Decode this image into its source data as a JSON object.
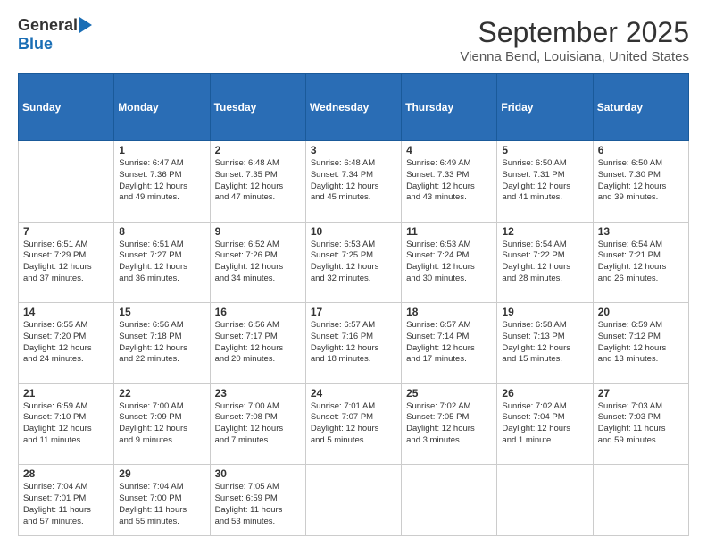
{
  "header": {
    "logo_general": "General",
    "logo_blue": "Blue",
    "month_title": "September 2025",
    "location": "Vienna Bend, Louisiana, United States"
  },
  "calendar": {
    "days_of_week": [
      "Sunday",
      "Monday",
      "Tuesday",
      "Wednesday",
      "Thursday",
      "Friday",
      "Saturday"
    ],
    "weeks": [
      [
        {
          "day": "",
          "info": ""
        },
        {
          "day": "1",
          "info": "Sunrise: 6:47 AM\nSunset: 7:36 PM\nDaylight: 12 hours\nand 49 minutes."
        },
        {
          "day": "2",
          "info": "Sunrise: 6:48 AM\nSunset: 7:35 PM\nDaylight: 12 hours\nand 47 minutes."
        },
        {
          "day": "3",
          "info": "Sunrise: 6:48 AM\nSunset: 7:34 PM\nDaylight: 12 hours\nand 45 minutes."
        },
        {
          "day": "4",
          "info": "Sunrise: 6:49 AM\nSunset: 7:33 PM\nDaylight: 12 hours\nand 43 minutes."
        },
        {
          "day": "5",
          "info": "Sunrise: 6:50 AM\nSunset: 7:31 PM\nDaylight: 12 hours\nand 41 minutes."
        },
        {
          "day": "6",
          "info": "Sunrise: 6:50 AM\nSunset: 7:30 PM\nDaylight: 12 hours\nand 39 minutes."
        }
      ],
      [
        {
          "day": "7",
          "info": "Sunrise: 6:51 AM\nSunset: 7:29 PM\nDaylight: 12 hours\nand 37 minutes."
        },
        {
          "day": "8",
          "info": "Sunrise: 6:51 AM\nSunset: 7:27 PM\nDaylight: 12 hours\nand 36 minutes."
        },
        {
          "day": "9",
          "info": "Sunrise: 6:52 AM\nSunset: 7:26 PM\nDaylight: 12 hours\nand 34 minutes."
        },
        {
          "day": "10",
          "info": "Sunrise: 6:53 AM\nSunset: 7:25 PM\nDaylight: 12 hours\nand 32 minutes."
        },
        {
          "day": "11",
          "info": "Sunrise: 6:53 AM\nSunset: 7:24 PM\nDaylight: 12 hours\nand 30 minutes."
        },
        {
          "day": "12",
          "info": "Sunrise: 6:54 AM\nSunset: 7:22 PM\nDaylight: 12 hours\nand 28 minutes."
        },
        {
          "day": "13",
          "info": "Sunrise: 6:54 AM\nSunset: 7:21 PM\nDaylight: 12 hours\nand 26 minutes."
        }
      ],
      [
        {
          "day": "14",
          "info": "Sunrise: 6:55 AM\nSunset: 7:20 PM\nDaylight: 12 hours\nand 24 minutes."
        },
        {
          "day": "15",
          "info": "Sunrise: 6:56 AM\nSunset: 7:18 PM\nDaylight: 12 hours\nand 22 minutes."
        },
        {
          "day": "16",
          "info": "Sunrise: 6:56 AM\nSunset: 7:17 PM\nDaylight: 12 hours\nand 20 minutes."
        },
        {
          "day": "17",
          "info": "Sunrise: 6:57 AM\nSunset: 7:16 PM\nDaylight: 12 hours\nand 18 minutes."
        },
        {
          "day": "18",
          "info": "Sunrise: 6:57 AM\nSunset: 7:14 PM\nDaylight: 12 hours\nand 17 minutes."
        },
        {
          "day": "19",
          "info": "Sunrise: 6:58 AM\nSunset: 7:13 PM\nDaylight: 12 hours\nand 15 minutes."
        },
        {
          "day": "20",
          "info": "Sunrise: 6:59 AM\nSunset: 7:12 PM\nDaylight: 12 hours\nand 13 minutes."
        }
      ],
      [
        {
          "day": "21",
          "info": "Sunrise: 6:59 AM\nSunset: 7:10 PM\nDaylight: 12 hours\nand 11 minutes."
        },
        {
          "day": "22",
          "info": "Sunrise: 7:00 AM\nSunset: 7:09 PM\nDaylight: 12 hours\nand 9 minutes."
        },
        {
          "day": "23",
          "info": "Sunrise: 7:00 AM\nSunset: 7:08 PM\nDaylight: 12 hours\nand 7 minutes."
        },
        {
          "day": "24",
          "info": "Sunrise: 7:01 AM\nSunset: 7:07 PM\nDaylight: 12 hours\nand 5 minutes."
        },
        {
          "day": "25",
          "info": "Sunrise: 7:02 AM\nSunset: 7:05 PM\nDaylight: 12 hours\nand 3 minutes."
        },
        {
          "day": "26",
          "info": "Sunrise: 7:02 AM\nSunset: 7:04 PM\nDaylight: 12 hours\nand 1 minute."
        },
        {
          "day": "27",
          "info": "Sunrise: 7:03 AM\nSunset: 7:03 PM\nDaylight: 11 hours\nand 59 minutes."
        }
      ],
      [
        {
          "day": "28",
          "info": "Sunrise: 7:04 AM\nSunset: 7:01 PM\nDaylight: 11 hours\nand 57 minutes."
        },
        {
          "day": "29",
          "info": "Sunrise: 7:04 AM\nSunset: 7:00 PM\nDaylight: 11 hours\nand 55 minutes."
        },
        {
          "day": "30",
          "info": "Sunrise: 7:05 AM\nSunset: 6:59 PM\nDaylight: 11 hours\nand 53 minutes."
        },
        {
          "day": "",
          "info": ""
        },
        {
          "day": "",
          "info": ""
        },
        {
          "day": "",
          "info": ""
        },
        {
          "day": "",
          "info": ""
        }
      ]
    ]
  }
}
